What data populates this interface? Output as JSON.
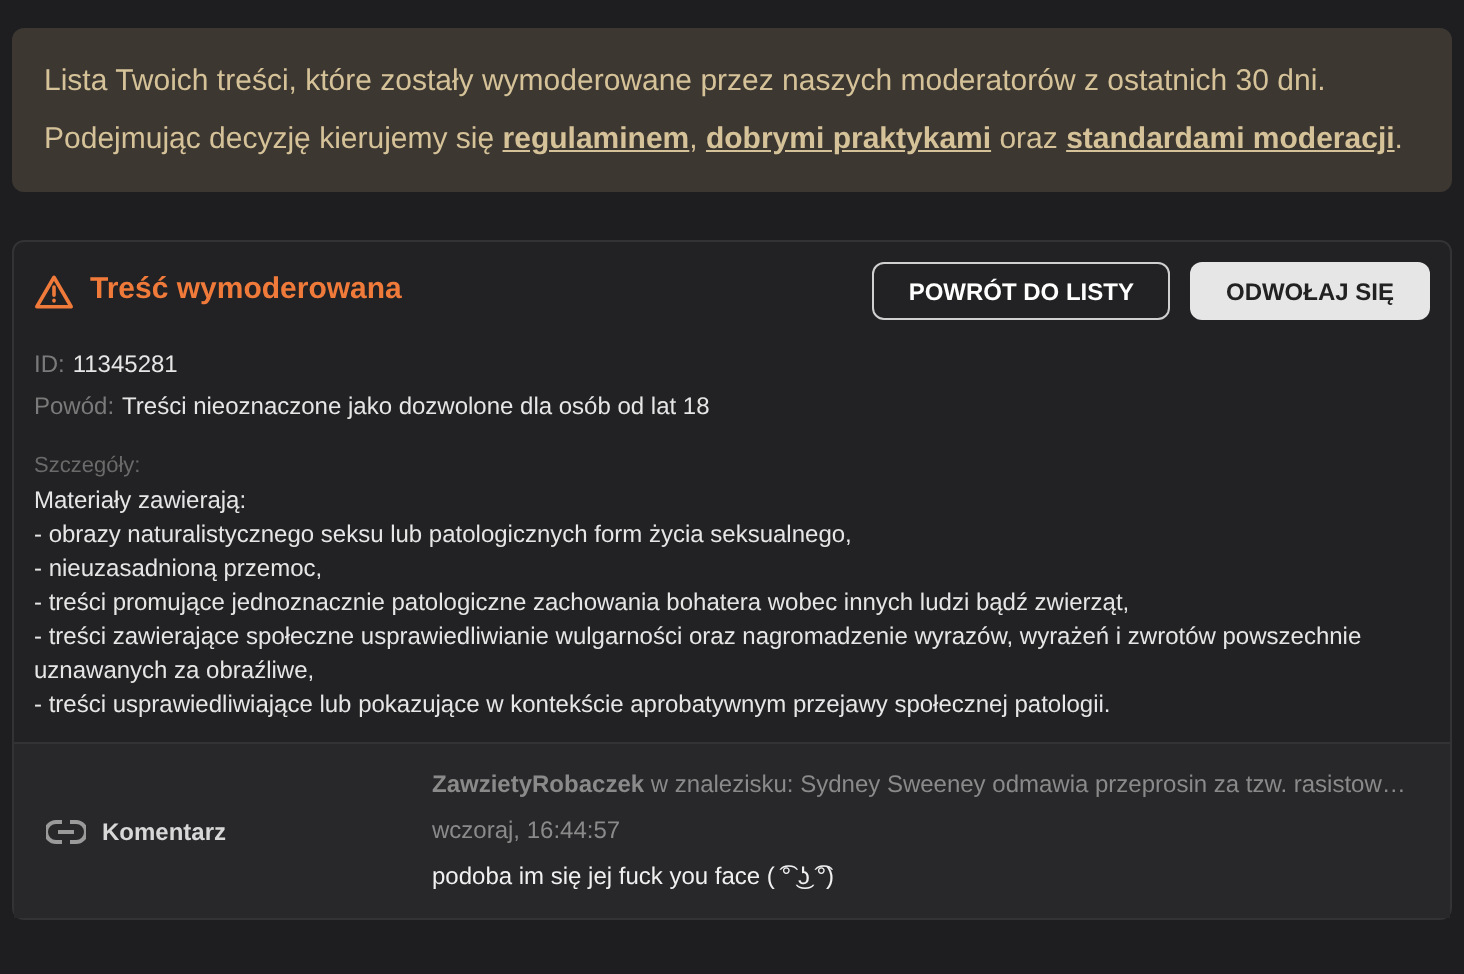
{
  "notice": {
    "line1": "Lista Twoich treści, które zostały wymoderowane przez naszych moderatorów z ostatnich 30 dni.",
    "line2": [
      {
        "kind": "text",
        "text": "Podejmując decyzję kierujemy się "
      },
      {
        "kind": "link",
        "text": "regulaminem"
      },
      {
        "kind": "text",
        "text": ", "
      },
      {
        "kind": "link",
        "text": "dobrymi praktykami"
      },
      {
        "kind": "text",
        "text": " oraz "
      },
      {
        "kind": "link",
        "text": "standardami moderacji"
      },
      {
        "kind": "text",
        "text": "."
      }
    ]
  },
  "card": {
    "title": "Treść wymoderowana",
    "buttons": [
      {
        "label": "POWRÓT DO LISTY",
        "kind": "outline"
      },
      {
        "label": "ODWOŁAJ SIĘ",
        "kind": "filled"
      }
    ],
    "fields": [
      {
        "label": "ID:",
        "value": "11345281"
      },
      {
        "label": "Powód:",
        "value": "Treści nieoznaczone jako dozwolone dla osób od lat 18"
      }
    ],
    "details_label": "Szczegóły:",
    "details": [
      "Materiały zawierają:",
      "- obrazy naturalistycznego seksu lub patologicznych form życia seksualnego,",
      "- nieuzasadnioną przemoc,",
      "- treści promujące jednoznacznie patologiczne zachowania bohatera wobec innych ludzi bądź zwierząt,",
      "- treści zawierające społeczne usprawiedliwianie wulgarności oraz nagromadzenie wyrazów, wyrażeń i zwrotów powszechnie uznawanych za obraźliwe,",
      "- treści usprawiedliwiające lub pokazujące w kontekście aprobatywnym przejawy społecznej patologii."
    ]
  },
  "comment": {
    "type_label": "Komentarz",
    "author": "ZawzietyRobaczek",
    "context": "w znalezisku: Sydney Sweeney odmawia przeprosin za tzw. rasistow…",
    "time": "wczoraj, 16:44:57",
    "text": "podoba im się jej fuck you face ( ͡° ͜ʖ ͡°)"
  }
}
